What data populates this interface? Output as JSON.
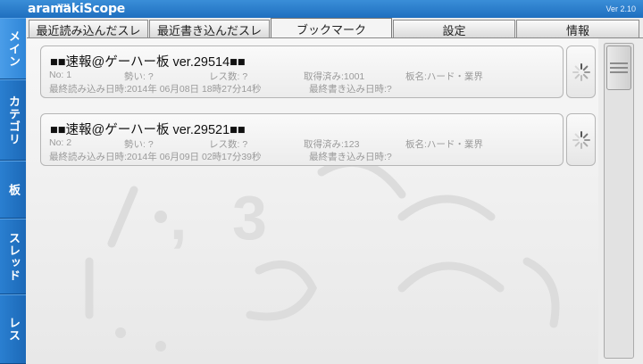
{
  "app": {
    "logo_small": "zzzz",
    "logo": "aramakiScope",
    "version": "Ver 2.10"
  },
  "sidenav": [
    {
      "label": "メイン"
    },
    {
      "label": "カテゴリ"
    },
    {
      "label": "板"
    },
    {
      "label": "スレッド"
    },
    {
      "label": "レス"
    }
  ],
  "tabs": [
    {
      "label": "最近読み込んだスレ"
    },
    {
      "label": "最近書き込んだスレ"
    },
    {
      "label": "ブックマーク"
    },
    {
      "label": "設定"
    },
    {
      "label": "情報"
    }
  ],
  "bookmarks": [
    {
      "title": "■■速報@ゲーハー板 ver.29514■■",
      "no": "No: 1",
      "momentum": "勢い: ?",
      "res_count": "レス数: ?",
      "acquired": "取得済み:1001",
      "board": "板名:ハード・業界",
      "last_read": "最終読み込み日時:2014年 06月08日 18時27分14秒",
      "last_write": "最終書き込み日時:?"
    },
    {
      "title": "■■速報@ゲーハー板 ver.29521■■",
      "no": "No: 2",
      "momentum": "勢い: ?",
      "res_count": "レス数: ?",
      "acquired": "取得済み:123",
      "board": "板名:ハード・業界",
      "last_read": "最終読み込み日時:2014年 06月09日 02時17分39秒",
      "last_write": "最終書き込み日時:?"
    }
  ],
  "colors": {
    "accent": "#1f6fbf",
    "meta_text": "#9a9a9a"
  },
  "icons": {
    "refresh": "spinner-icon",
    "scroll_grip": "grip-icon"
  }
}
